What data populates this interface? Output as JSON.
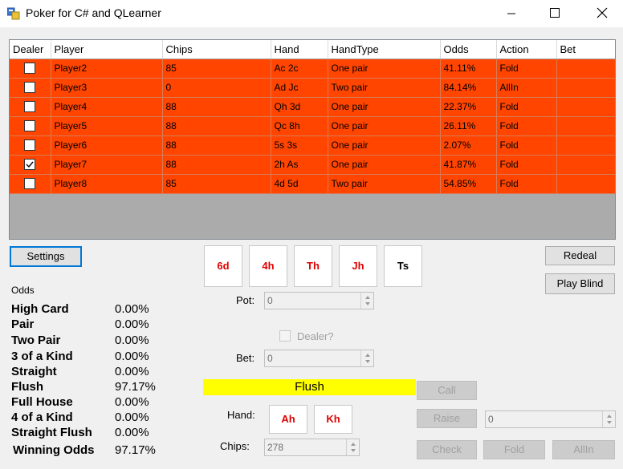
{
  "window": {
    "title": "Poker for C# and QLearner"
  },
  "grid": {
    "columns": [
      "Dealer",
      "Player",
      "Chips",
      "Hand",
      "HandType",
      "Odds",
      "Action",
      "Bet"
    ],
    "rows": [
      {
        "dealer": false,
        "player": "Player2",
        "chips": "85",
        "hand": "Ac 2c",
        "handtype": "One pair",
        "odds": "41.11%",
        "action": "Fold",
        "bet": ""
      },
      {
        "dealer": false,
        "player": "Player3",
        "chips": "0",
        "hand": "Ad Jc",
        "handtype": "Two pair",
        "odds": "84.14%",
        "action": "AllIn",
        "bet": ""
      },
      {
        "dealer": false,
        "player": "Player4",
        "chips": "88",
        "hand": "Qh 3d",
        "handtype": "One pair",
        "odds": "22.37%",
        "action": "Fold",
        "bet": ""
      },
      {
        "dealer": false,
        "player": "Player5",
        "chips": "88",
        "hand": "Qc 8h",
        "handtype": "One pair",
        "odds": "26.11%",
        "action": "Fold",
        "bet": ""
      },
      {
        "dealer": false,
        "player": "Player6",
        "chips": "88",
        "hand": "5s 3s",
        "handtype": "One pair",
        "odds": "2.07%",
        "action": "Fold",
        "bet": ""
      },
      {
        "dealer": true,
        "player": "Player7",
        "chips": "88",
        "hand": "2h As",
        "handtype": "One pair",
        "odds": "41.87%",
        "action": "Fold",
        "bet": ""
      },
      {
        "dealer": false,
        "player": "Player8",
        "chips": "85",
        "hand": "4d 5d",
        "handtype": "Two pair",
        "odds": "54.85%",
        "action": "Fold",
        "bet": ""
      }
    ]
  },
  "buttons": {
    "settings": "Settings",
    "redeal": "Redeal",
    "play_blind": "Play Blind",
    "call": "Call",
    "raise": "Raise",
    "check": "Check",
    "fold": "Fold",
    "allin": "AllIn"
  },
  "board_cards": [
    "6d",
    "4h",
    "Th",
    "Jh",
    "Ts"
  ],
  "pot": {
    "label": "Pot:",
    "value": "0"
  },
  "dealer_checkbox": {
    "label": "Dealer?"
  },
  "bet": {
    "label": "Bet:",
    "value": "0"
  },
  "hand_type": "Flush",
  "hand": {
    "label": "Hand:",
    "cards": [
      "Ah",
      "Kh"
    ]
  },
  "chips": {
    "label": "Chips:",
    "value": "278"
  },
  "raise_amount": "0",
  "odds": {
    "header": "Odds",
    "rows": [
      {
        "name": "High Card",
        "value": "0.00%"
      },
      {
        "name": "Pair",
        "value": "0.00%"
      },
      {
        "name": "Two Pair",
        "value": "0.00%"
      },
      {
        "name": "3 of a Kind",
        "value": "0.00%"
      },
      {
        "name": "Straight",
        "value": "0.00%"
      },
      {
        "name": "Flush",
        "value": "97.17%"
      },
      {
        "name": "Full House",
        "value": "0.00%"
      },
      {
        "name": "4 of a Kind",
        "value": "0.00%"
      },
      {
        "name": "Straight Flush",
        "value": "0.00%"
      },
      {
        "name": "Winning Odds",
        "value": "97.17%"
      }
    ]
  },
  "colors": {
    "row_bg": "#ff4500",
    "hand_type_bg": "#ffff00",
    "card_red": "#e00000"
  },
  "icons": [
    "app-icon",
    "minimize-icon",
    "maximize-icon",
    "close-icon",
    "checkmark-icon",
    "spin-up-icon",
    "spin-down-icon"
  ]
}
